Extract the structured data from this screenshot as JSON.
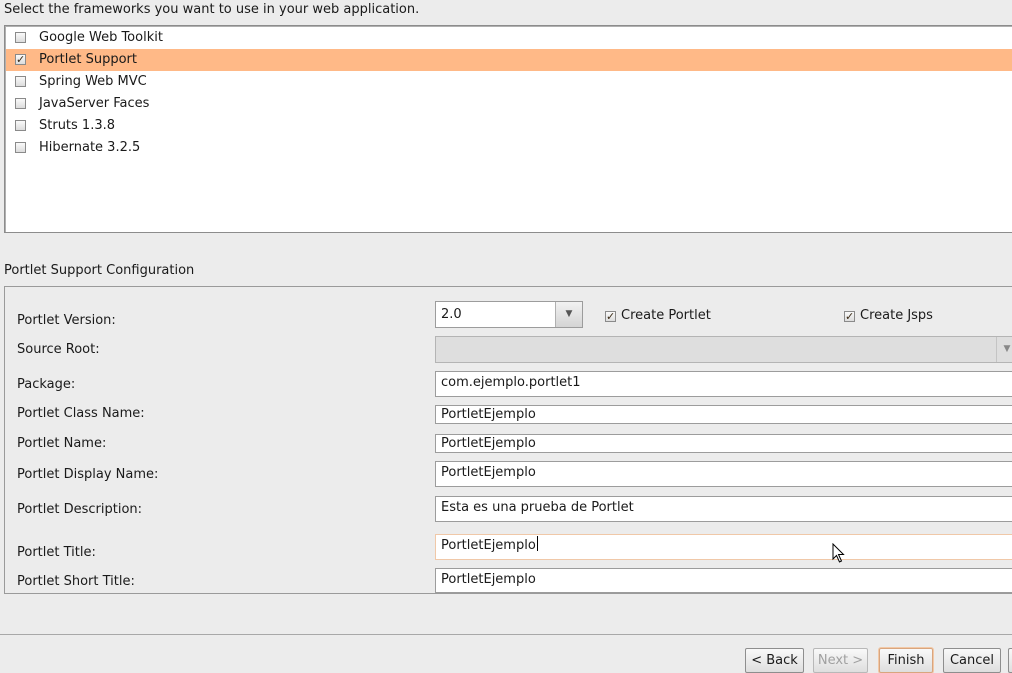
{
  "prompt": "Select the frameworks you want to use in your web application.",
  "frameworks": [
    {
      "label": "Google Web Toolkit",
      "checked": false
    },
    {
      "label": "Portlet Support",
      "checked": true
    },
    {
      "label": "Spring Web MVC",
      "checked": false
    },
    {
      "label": "JavaServer Faces",
      "checked": false
    },
    {
      "label": "Struts 1.3.8",
      "checked": false
    },
    {
      "label": "Hibernate 3.2.5",
      "checked": false
    }
  ],
  "config": {
    "section_title": "Portlet Support Configuration",
    "labels": {
      "version": "Portlet Version:",
      "source_root": "Source Root:",
      "package": "Package:",
      "class_name": "Portlet Class Name:",
      "name": "Portlet Name:",
      "display_name": "Portlet Display Name:",
      "description": "Portlet Description:",
      "title": "Portlet Title:",
      "short_title": "Portlet Short Title:"
    },
    "values": {
      "version": "2.0",
      "source_root": "",
      "package": "com.ejemplo.portlet1",
      "class_name": "PortletEjemplo",
      "name": "PortletEjemplo",
      "display_name": "PortletEjemplo",
      "description": "Esta es una prueba de Portlet",
      "title": "PortletEjemplo",
      "short_title": "PortletEjemplo"
    },
    "create_portlet": {
      "label": "Create Portlet",
      "checked": true
    },
    "create_jsps": {
      "label": "Create Jsps",
      "checked": true
    }
  },
  "buttons": {
    "back": "< Back",
    "next": "Next >",
    "finish": "Finish",
    "cancel": "Cancel"
  },
  "icons": {
    "combo_arrow": "chevron-down-icon",
    "pointer": "mouse-pointer-icon",
    "check": "checkmark-icon"
  },
  "colors": {
    "selection": "#ffb987",
    "window_bg": "#ececec"
  }
}
